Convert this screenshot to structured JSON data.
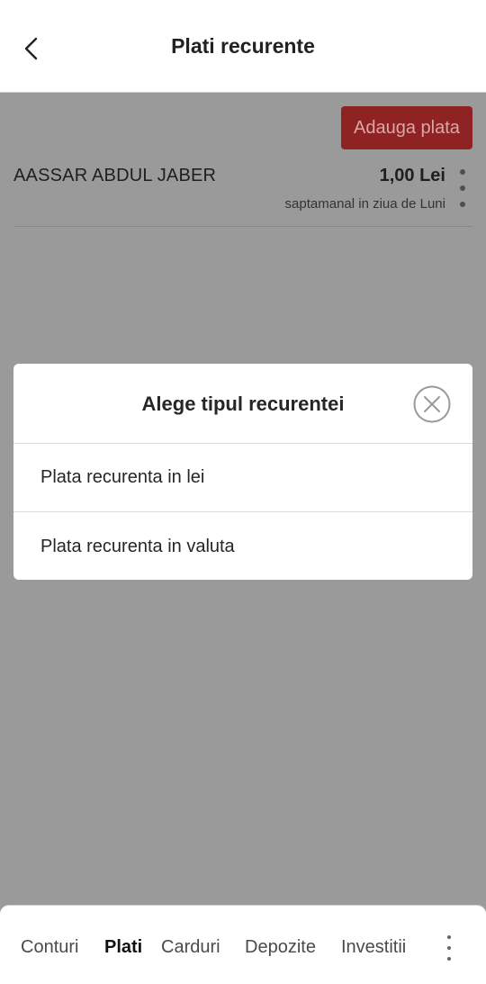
{
  "header": {
    "title": "Plati recurente",
    "back_icon": "chevron-left-icon"
  },
  "toolbar": {
    "add_payment_label": "Adauga plata",
    "add_payment_color": "#8f2222"
  },
  "payments": [
    {
      "payee": "AASSAR ABDUL JABER",
      "amount": "1,00 Lei",
      "frequency": "saptamanal in ziua de Luni",
      "menu_icon": "more-vertical-icon"
    }
  ],
  "modal": {
    "title": "Alege tipul recurentei",
    "close_icon": "close-circle-icon",
    "options": [
      {
        "label": "Plata recurenta in lei"
      },
      {
        "label": "Plata recurenta in valuta"
      }
    ]
  },
  "bottom_nav": {
    "items": [
      {
        "label": "Conturi",
        "active": false
      },
      {
        "label": "Plati",
        "active": true
      },
      {
        "label": "Carduri",
        "active": false
      },
      {
        "label": "Depozite",
        "active": false
      },
      {
        "label": "Investitii",
        "active": false
      }
    ],
    "more_icon": "more-vertical-icon"
  },
  "colors": {
    "overlay": "#9a9a9a",
    "surface": "#ffffff",
    "text": "#222222"
  }
}
